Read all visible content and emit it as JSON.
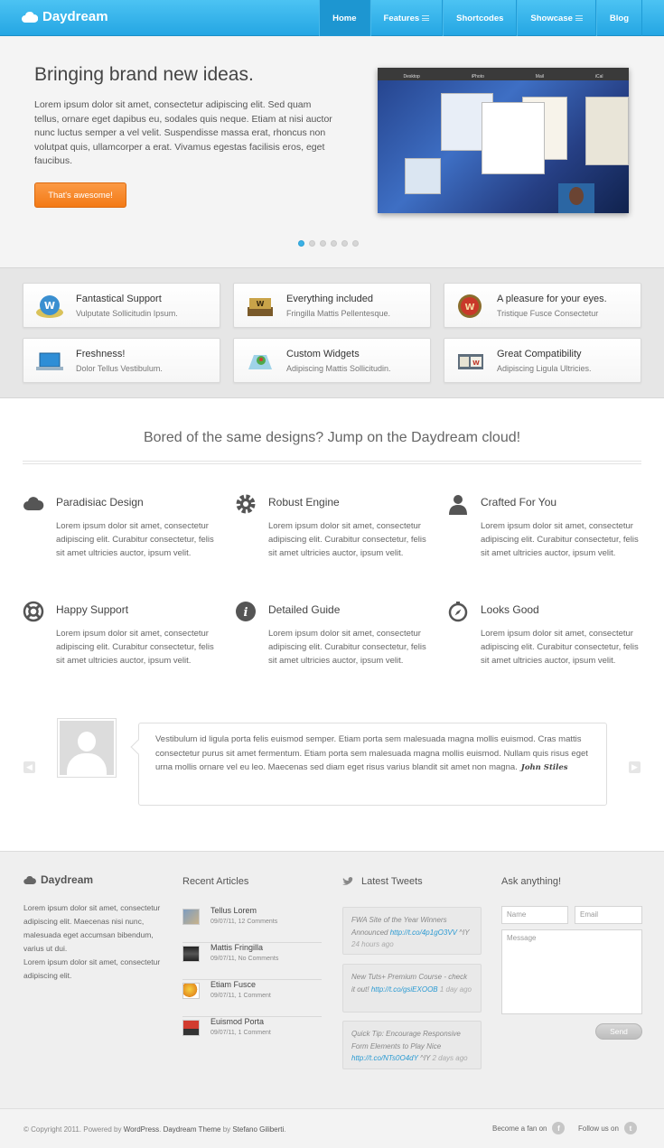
{
  "header": {
    "logo": "Daydream",
    "nav": [
      {
        "label": "Home",
        "active": true
      },
      {
        "label": "Features",
        "menu": true
      },
      {
        "label": "Shortcodes"
      },
      {
        "label": "Showcase",
        "menu": true
      },
      {
        "label": "Blog"
      }
    ]
  },
  "hero": {
    "title": "Bringing brand new ideas.",
    "body": "Lorem ipsum dolor sit amet, consectetur adipiscing elit. Sed quam tellus, ornare eget dapibus eu, sodales quis neque. Etiam at nisi auctor nunc luctus semper a vel velit. Suspendisse massa erat, rhoncus non volutpat quis, ullamcorper a erat. Vivamus egestas facilisis eros, eget faucibus.",
    "cta": "That's awesome!",
    "screen_labels": [
      "Desktop",
      "iPhoto",
      "Mail",
      "iCal"
    ],
    "slide_count": 6,
    "active_slide": 1
  },
  "feature_boxes": [
    {
      "title": "Fantastical Support",
      "sub": "Vulputate Sollicitudin Ipsum.",
      "icon": "globe-icon"
    },
    {
      "title": "Everything included",
      "sub": "Fringilla Mattis Pellentesque.",
      "icon": "book-icon"
    },
    {
      "title": "A pleasure for your eyes.",
      "sub": "Tristique Fusce Consectetur",
      "icon": "wordpress-badge-icon"
    },
    {
      "title": "Freshness!",
      "sub": "Dolor Tellus Vestibulum.",
      "icon": "laptop-icon"
    },
    {
      "title": "Custom Widgets",
      "sub": "Adipiscing Mattis Sollicitudin.",
      "icon": "map-icon"
    },
    {
      "title": "Great Compatibility",
      "sub": "Adipiscing Ligula Ultricies.",
      "icon": "browser-icon"
    }
  ],
  "tagline": "Bored of the same designs? Jump on the Daydream cloud!",
  "features": [
    {
      "title": "Paradisiac Design",
      "icon": "cloud-icon",
      "body": "Lorem ipsum dolor sit amet, consectetur adipiscing elit. Curabitur consectetur, felis sit amet ultricies auctor, ipsum velit."
    },
    {
      "title": "Robust Engine",
      "icon": "gear-icon",
      "body": "Lorem ipsum dolor sit amet, consectetur adipiscing elit. Curabitur consectetur, felis sit amet ultricies auctor, ipsum velit."
    },
    {
      "title": "Crafted For You",
      "icon": "user-icon",
      "body": "Lorem ipsum dolor sit amet, consectetur adipiscing elit. Curabitur consectetur, felis sit amet ultricies auctor, ipsum velit."
    },
    {
      "title": "Happy Support",
      "icon": "lifebuoy-icon",
      "body": "Lorem ipsum dolor sit amet, consectetur adipiscing elit. Curabitur consectetur, felis sit amet ultricies auctor, ipsum velit."
    },
    {
      "title": "Detailed Guide",
      "icon": "info-icon",
      "body": "Lorem ipsum dolor sit amet, consectetur adipiscing elit. Curabitur consectetur, felis sit amet ultricies auctor, ipsum velit."
    },
    {
      "title": "Looks Good",
      "icon": "compass-icon",
      "body": "Lorem ipsum dolor sit amet, consectetur adipiscing elit. Curabitur consectetur, felis sit amet ultricies auctor, ipsum velit."
    }
  ],
  "testimonial": {
    "text": "Vestibulum id ligula porta felis euismod semper. Etiam porta sem malesuada magna mollis euismod. Cras mattis consectetur purus sit amet fermentum. Etiam porta sem malesuada magna mollis euismod. Nullam quis risus eget urna mollis ornare vel eu leo. Maecenas sed diam eget risus varius blandit sit amet non magna.",
    "author": "John Stiles"
  },
  "footer": {
    "logo": "Daydream",
    "about": [
      "Lorem ipsum dolor sit amet, consectetur adipiscing elit. Maecenas nisi nunc, malesuada eget accumsan bibendum, varius ut dui.",
      "Lorem ipsum dolor sit amet, consectetur adipiscing elit."
    ],
    "recent_heading": "Recent Articles",
    "articles": [
      {
        "title": "Tellus Lorem",
        "meta": "09/07/11, 12 Comments"
      },
      {
        "title": "Mattis Fringilla",
        "meta": "09/07/11, No Comments"
      },
      {
        "title": "Etiam Fusce",
        "meta": "09/07/11, 1 Comment"
      },
      {
        "title": "Euismod Porta",
        "meta": "09/07/11, 1 Comment"
      }
    ],
    "tweets_heading": "Latest Tweets",
    "tweets": [
      {
        "text": "FWA Site of the Year Winners Announced",
        "link": "http://t.co/4p1gO3VV",
        "user": "^IY",
        "age": "24 hours ago"
      },
      {
        "text": "New Tuts+ Premium Course - check it out!",
        "link": "http://t.co/gsiEXOOB",
        "user": "",
        "age": "1 day ago"
      },
      {
        "text": "Quick Tip: Encourage Responsive Form Elements to Play Nice",
        "link": "http://t.co/NTs0O4dY",
        "user": "^IY",
        "age": "2 days ago"
      }
    ],
    "contact_heading": "Ask anything!",
    "name_placeholder": "Name",
    "email_placeholder": "Email",
    "message_placeholder": "Message",
    "send_label": "Send"
  },
  "bottom": {
    "copy_pre": "© Copyright 2011. Powered by ",
    "wordpress": "WordPress",
    "copy_mid": ". ",
    "theme": "Daydream Theme",
    "copy_by": " by ",
    "author": "Stefano Giliberti",
    "copy_end": ".",
    "fan_label": "Become a fan on",
    "follow_label": "Follow us on"
  }
}
